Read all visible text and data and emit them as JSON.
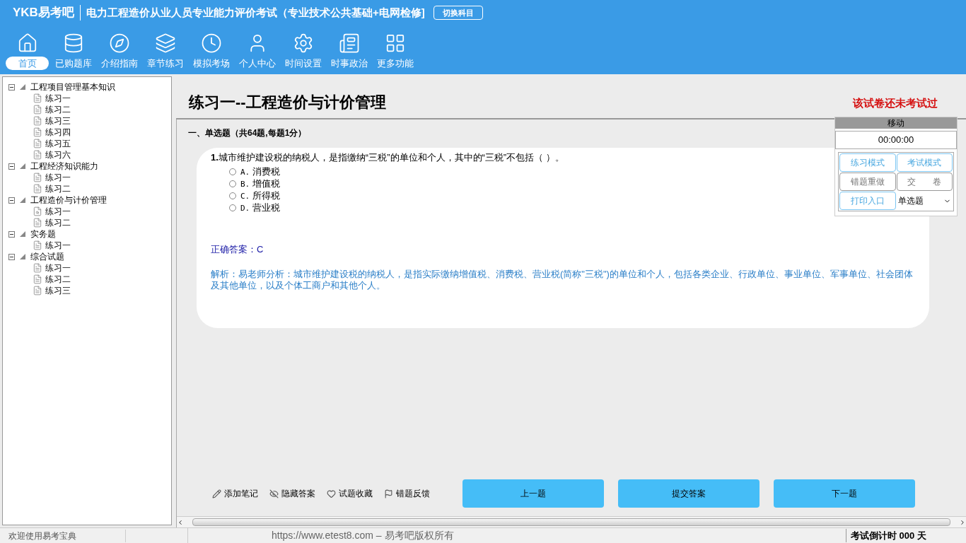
{
  "header": {
    "logo": "YKB易考吧",
    "title": "电力工程造价从业人员专业能力评价考试（专业技术公共基础+电网检修",
    "title_end": "]",
    "switch_button": "切换科目"
  },
  "nav": [
    {
      "label": "首页",
      "selected": true
    },
    {
      "label": "已购题库",
      "selected": false
    },
    {
      "label": "介绍指南",
      "selected": false
    },
    {
      "label": "章节练习",
      "selected": false
    },
    {
      "label": "模拟考场",
      "selected": false
    },
    {
      "label": "个人中心",
      "selected": false
    },
    {
      "label": "时间设置",
      "selected": false
    },
    {
      "label": "时事政治",
      "selected": false
    },
    {
      "label": "更多功能",
      "selected": false
    }
  ],
  "tree": [
    {
      "label": "工程项目管理基本知识",
      "expanded": true,
      "children": [
        {
          "label": "练习一",
          "current": false
        },
        {
          "label": "练习二",
          "current": false
        },
        {
          "label": "练习三",
          "current": false
        },
        {
          "label": "练习四",
          "current": false
        },
        {
          "label": "练习五",
          "current": false
        },
        {
          "label": "练习六",
          "current": false
        }
      ]
    },
    {
      "label": "工程经济知识能力",
      "expanded": true,
      "children": [
        {
          "label": "练习一",
          "current": false
        },
        {
          "label": "练习二",
          "current": false
        }
      ]
    },
    {
      "label": "工程造价与计价管理",
      "expanded": true,
      "children": [
        {
          "label": "练习一",
          "current": true
        },
        {
          "label": "练习二",
          "current": false
        }
      ]
    },
    {
      "label": "实务题",
      "expanded": true,
      "children": [
        {
          "label": "练习一",
          "current": false
        }
      ]
    },
    {
      "label": "综合试题",
      "expanded": true,
      "children": [
        {
          "label": "练习一",
          "current": false
        },
        {
          "label": "练习二",
          "current": false
        },
        {
          "label": "练习三",
          "current": false
        }
      ]
    }
  ],
  "paper": {
    "title": "练习一--工程造价与计价管理",
    "status": "该试卷还未考试过",
    "section": "一、单选题（共64题,每题1分）"
  },
  "question": {
    "number": "1.",
    "text": "城市维护建设税的纳税人，是指缴纳“三税”的单位和个人，其中的“三税”不包括（ ）。",
    "options": [
      {
        "label": "A.",
        "text": "消费税",
        "selected": false
      },
      {
        "label": "B.",
        "text": "增值税",
        "selected": false
      },
      {
        "label": "C.",
        "text": "所得税",
        "selected": false
      },
      {
        "label": "D.",
        "text": "营业税",
        "selected": false
      }
    ],
    "answer": "正确答案：C",
    "analysis": "解析：易老师分析：城市维护建设税的纳税人，是指实际缴纳增值税、消费税、营业税(简称\"三税\")的单位和个人，包括各类企业、行政单位、事业单位、军事单位、社会团体及其他单位，以及个体工商户和其他个人。"
  },
  "panel": {
    "move": "移动",
    "timer": "00:00:00",
    "buttons": [
      {
        "label": "练习模式",
        "kind": "mode"
      },
      {
        "label": "考试模式",
        "kind": "mode"
      },
      {
        "label": "错题重做",
        "kind": "plain"
      },
      {
        "label": "交　　卷",
        "kind": "plain"
      },
      {
        "label": "打印入口",
        "kind": "mode"
      }
    ],
    "type_select": "单选题"
  },
  "tools": [
    "添加笔记",
    "隐藏答案",
    "试题收藏",
    "错题反馈"
  ],
  "actions": [
    "上一题",
    "提交答案",
    "下一题"
  ],
  "status_bar": {
    "welcome": "欢迎使用易考宝典",
    "copyright": "https://www.etest8.com – 易考吧版权所有",
    "countdown": "考试倒计时 000 天"
  }
}
